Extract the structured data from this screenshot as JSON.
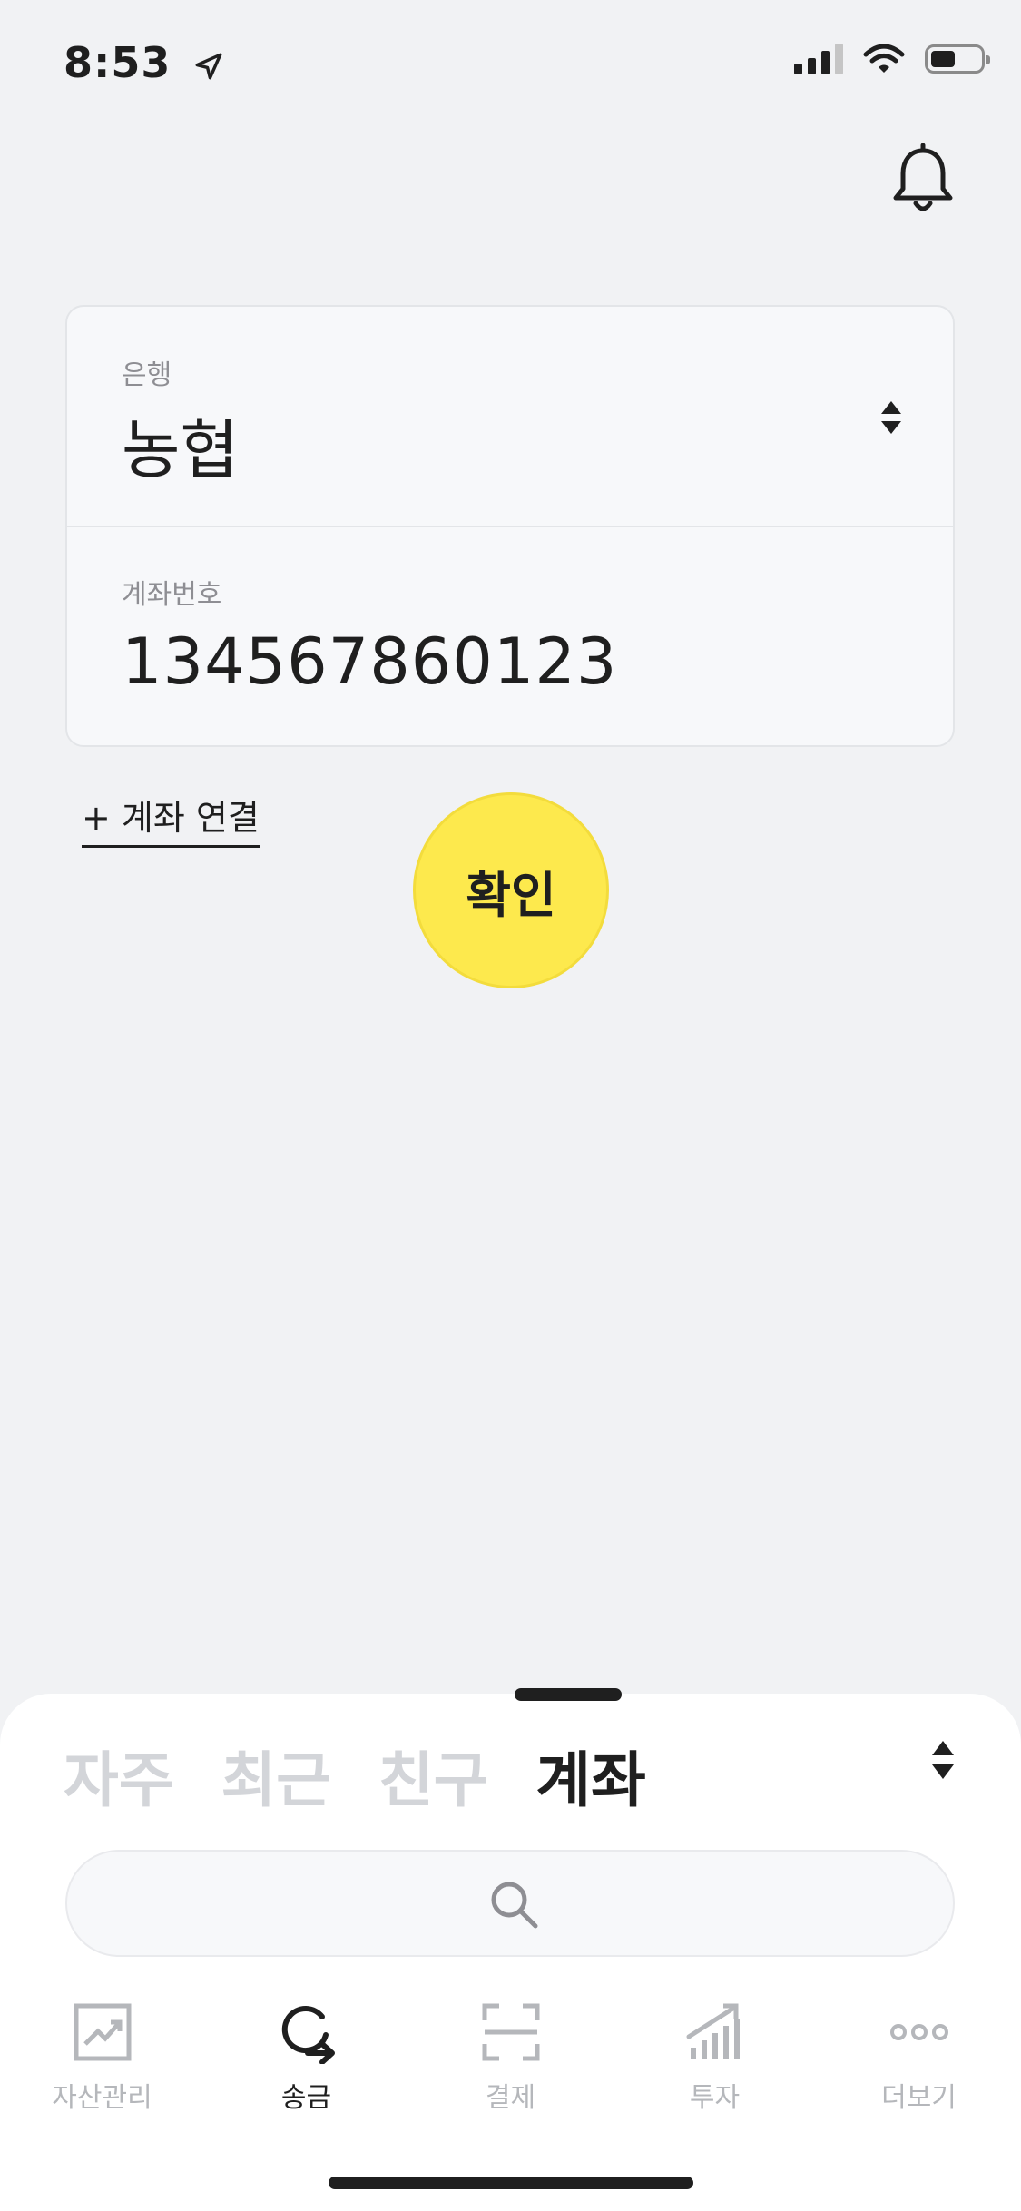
{
  "status_bar": {
    "time": "8:53"
  },
  "form": {
    "bank_label": "은행",
    "bank_value": "농협",
    "account_label": "계좌번호",
    "account_value": "134567860123"
  },
  "connect_link": "+ 계좌 연결",
  "confirm_label": "확인",
  "confirm_color": "#fde94d",
  "sheet": {
    "tabs": [
      {
        "label": "자주",
        "active": false
      },
      {
        "label": "최근",
        "active": false
      },
      {
        "label": "친구",
        "active": false
      },
      {
        "label": "계좌",
        "active": true
      }
    ]
  },
  "nav": [
    {
      "label": "자산관리",
      "icon": "asset-chart-icon",
      "active": false
    },
    {
      "label": "송금",
      "icon": "transfer-icon",
      "active": true
    },
    {
      "label": "결제",
      "icon": "scan-icon",
      "active": false
    },
    {
      "label": "투자",
      "icon": "invest-icon",
      "active": false
    },
    {
      "label": "더보기",
      "icon": "more-dots-icon",
      "active": false
    }
  ]
}
